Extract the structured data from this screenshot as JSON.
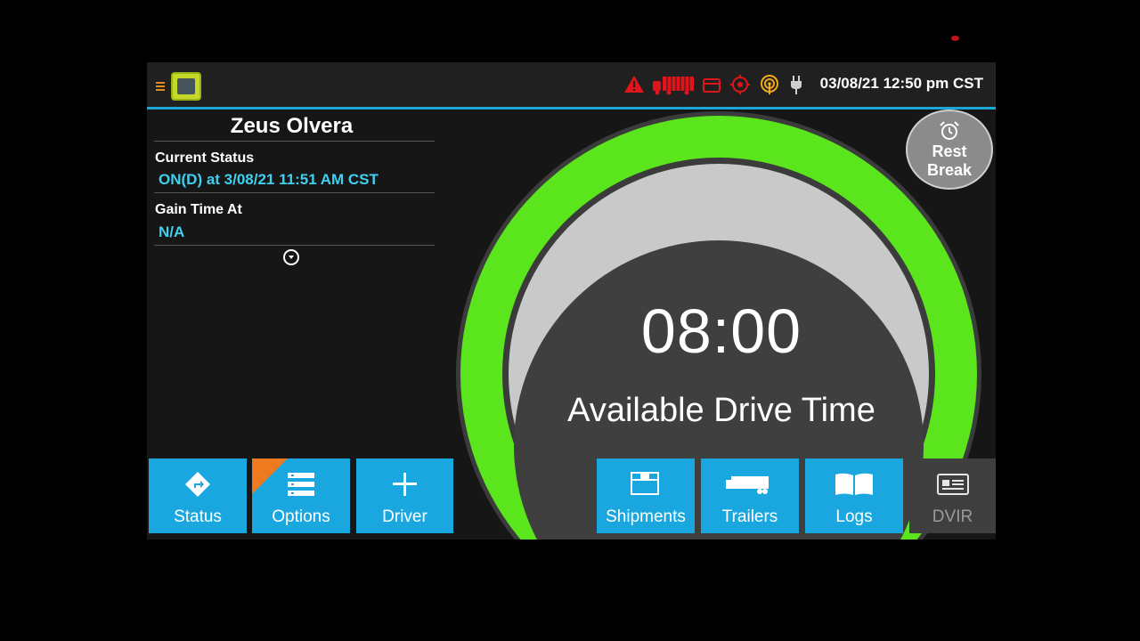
{
  "topbar": {
    "datetime": "03/08/21 12:50 pm CST",
    "status_icons": [
      "warning-icon",
      "truck-icon",
      "trailer-icon",
      "gps-icon",
      "wifi-icon",
      "power-plug-icon"
    ],
    "alert_color": "#e0151b",
    "accent_color": "#f0a818"
  },
  "driver": {
    "name": "Zeus Olvera",
    "current_status_label": "Current Status",
    "current_status_value": "ON(D) at 3/08/21 11:51 AM CST",
    "gain_time_label": "Gain Time At",
    "gain_time_value": "N/A"
  },
  "gauge": {
    "time": "08:00",
    "label": "Available Drive Time",
    "ring_color": "#5be51d",
    "inner_color": "#c9c9c9"
  },
  "rest_break": {
    "line1": "Rest",
    "line2": "Break"
  },
  "buttons": {
    "status": "Status",
    "options": "Options",
    "driver": "Driver",
    "shipments": "Shipments",
    "trailers": "Trailers",
    "logs": "Logs",
    "dvir": "DVIR"
  },
  "colors": {
    "button_blue": "#1aa7df",
    "accent_orange": "#ee7a1f",
    "topbar_line": "#1ba6d6"
  }
}
